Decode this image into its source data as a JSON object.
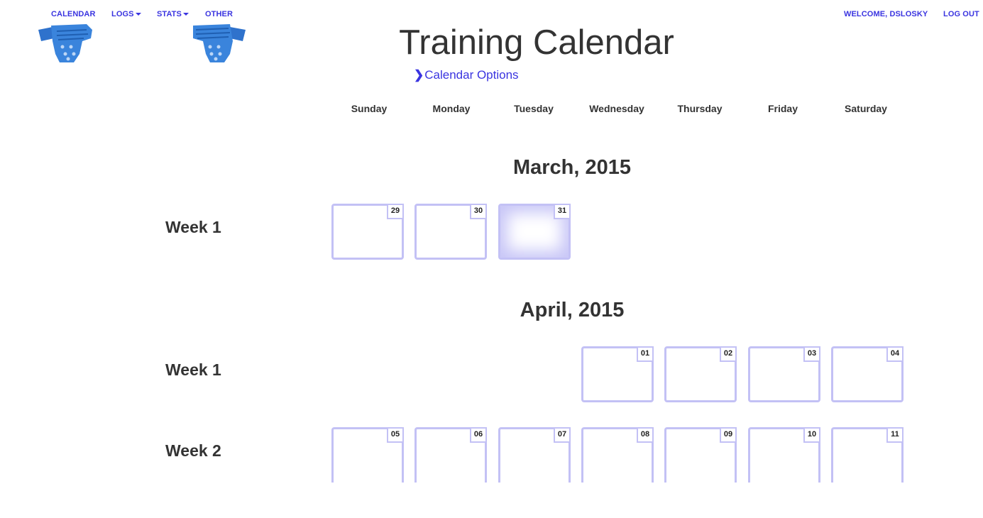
{
  "nav": {
    "calendar": "CALENDAR",
    "logs": "LOGS",
    "stats": "STATS",
    "other": "OTHER",
    "welcome": "WELCOME, DSLOSKY",
    "logout": "LOG OUT"
  },
  "page": {
    "title": "Training Calendar",
    "options_label": "Calendar Options"
  },
  "weekdays": [
    "Sunday",
    "Monday",
    "Tuesday",
    "Wednesday",
    "Thursday",
    "Friday",
    "Saturday"
  ],
  "months": [
    {
      "label": "March, 2015",
      "weeks": [
        {
          "label": "Week 1",
          "days": [
            "29",
            "30",
            "31"
          ]
        }
      ]
    },
    {
      "label": "April, 2015",
      "weeks": [
        {
          "label": "Week 1",
          "days": [
            "01",
            "02",
            "03",
            "04"
          ]
        },
        {
          "label": "Week 2",
          "days": [
            "05",
            "06",
            "07",
            "08",
            "09",
            "10",
            "11"
          ]
        }
      ]
    }
  ],
  "colors": {
    "link": "#3a34e0",
    "cell_border": "#c3c1f5",
    "today_glow": "#c8c6f7",
    "logo": "#3a7fd6"
  },
  "icons": {
    "logo_left": "climbing-hold-logo",
    "logo_right": "climbing-hold-logo",
    "options": "chevron-right-icon"
  }
}
